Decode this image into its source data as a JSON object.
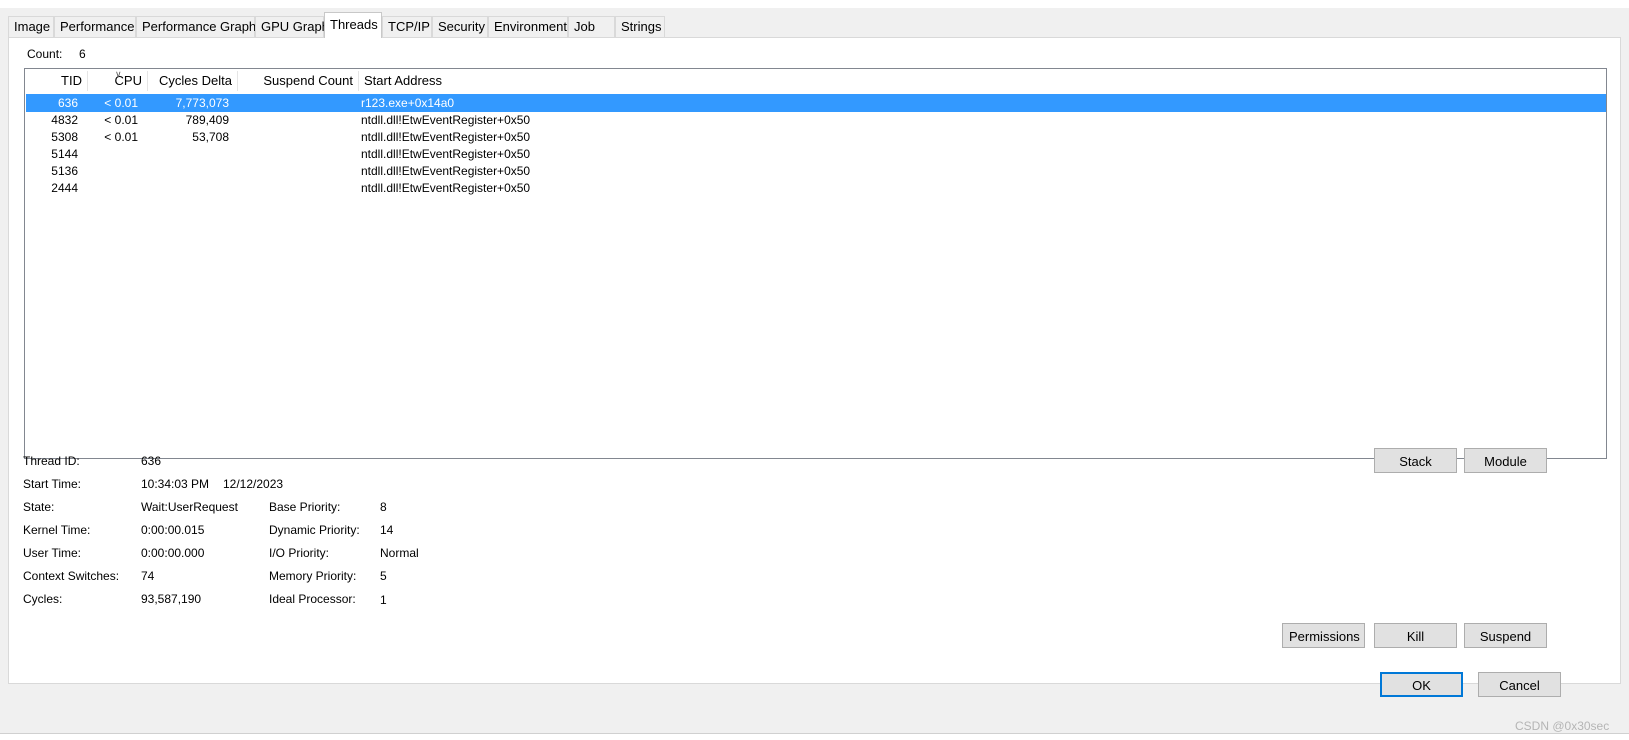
{
  "tabs": [
    {
      "label": "Image"
    },
    {
      "label": "Performance"
    },
    {
      "label": "Performance Graph"
    },
    {
      "label": "GPU Graph"
    },
    {
      "label": "Threads",
      "active": true
    },
    {
      "label": "TCP/IP"
    },
    {
      "label": "Security"
    },
    {
      "label": "Environment"
    },
    {
      "label": "Job"
    },
    {
      "label": "Strings"
    }
  ],
  "count": {
    "label": "Count:",
    "value": "6"
  },
  "columns": {
    "tid": "TID",
    "cpu": "CPU",
    "cycles": "Cycles Delta",
    "suspend": "Suspend Count",
    "start": "Start Address",
    "sorted_by": "CPU"
  },
  "threads": [
    {
      "tid": "636",
      "cpu": "< 0.01",
      "cycles": "7,773,073",
      "suspend": "",
      "start": "r123.exe+0x14a0",
      "selected": true
    },
    {
      "tid": "4832",
      "cpu": "< 0.01",
      "cycles": "789,409",
      "suspend": "",
      "start": "ntdll.dll!EtwEventRegister+0x50"
    },
    {
      "tid": "5308",
      "cpu": "< 0.01",
      "cycles": "53,708",
      "suspend": "",
      "start": "ntdll.dll!EtwEventRegister+0x50"
    },
    {
      "tid": "5144",
      "cpu": "",
      "cycles": "",
      "suspend": "",
      "start": "ntdll.dll!EtwEventRegister+0x50"
    },
    {
      "tid": "5136",
      "cpu": "",
      "cycles": "",
      "suspend": "",
      "start": "ntdll.dll!EtwEventRegister+0x50"
    },
    {
      "tid": "2444",
      "cpu": "",
      "cycles": "",
      "suspend": "",
      "start": "ntdll.dll!EtwEventRegister+0x50"
    }
  ],
  "details": {
    "thread_id_label": "Thread ID:",
    "thread_id": "636",
    "start_time_label": "Start Time:",
    "start_time": "10:34:03 PM",
    "start_date": "12/12/2023",
    "state_label": "State:",
    "state": "Wait:UserRequest",
    "kernel_time_label": "Kernel Time:",
    "kernel_time": "0:00:00.015",
    "user_time_label": "User Time:",
    "user_time": "0:00:00.000",
    "context_switches_label": "Context Switches:",
    "context_switches": "74",
    "cycles_label": "Cycles:",
    "cycles": "93,587,190",
    "base_priority_label": "Base Priority:",
    "base_priority": "8",
    "dynamic_priority_label": "Dynamic Priority:",
    "dynamic_priority": "14",
    "io_priority_label": "I/O Priority:",
    "io_priority": "Normal",
    "memory_priority_label": "Memory Priority:",
    "memory_priority": "5",
    "ideal_processor_label": "Ideal Processor:",
    "ideal_processor": "1"
  },
  "buttons": {
    "stack": "Stack",
    "module": "Module",
    "permissions": "Permissions",
    "kill": "Kill",
    "suspend": "Suspend",
    "ok": "OK",
    "cancel": "Cancel"
  },
  "watermark": "CSDN @0x30sec",
  "colors": {
    "selection": "#3399ff",
    "default_button_border": "#0078d7"
  }
}
